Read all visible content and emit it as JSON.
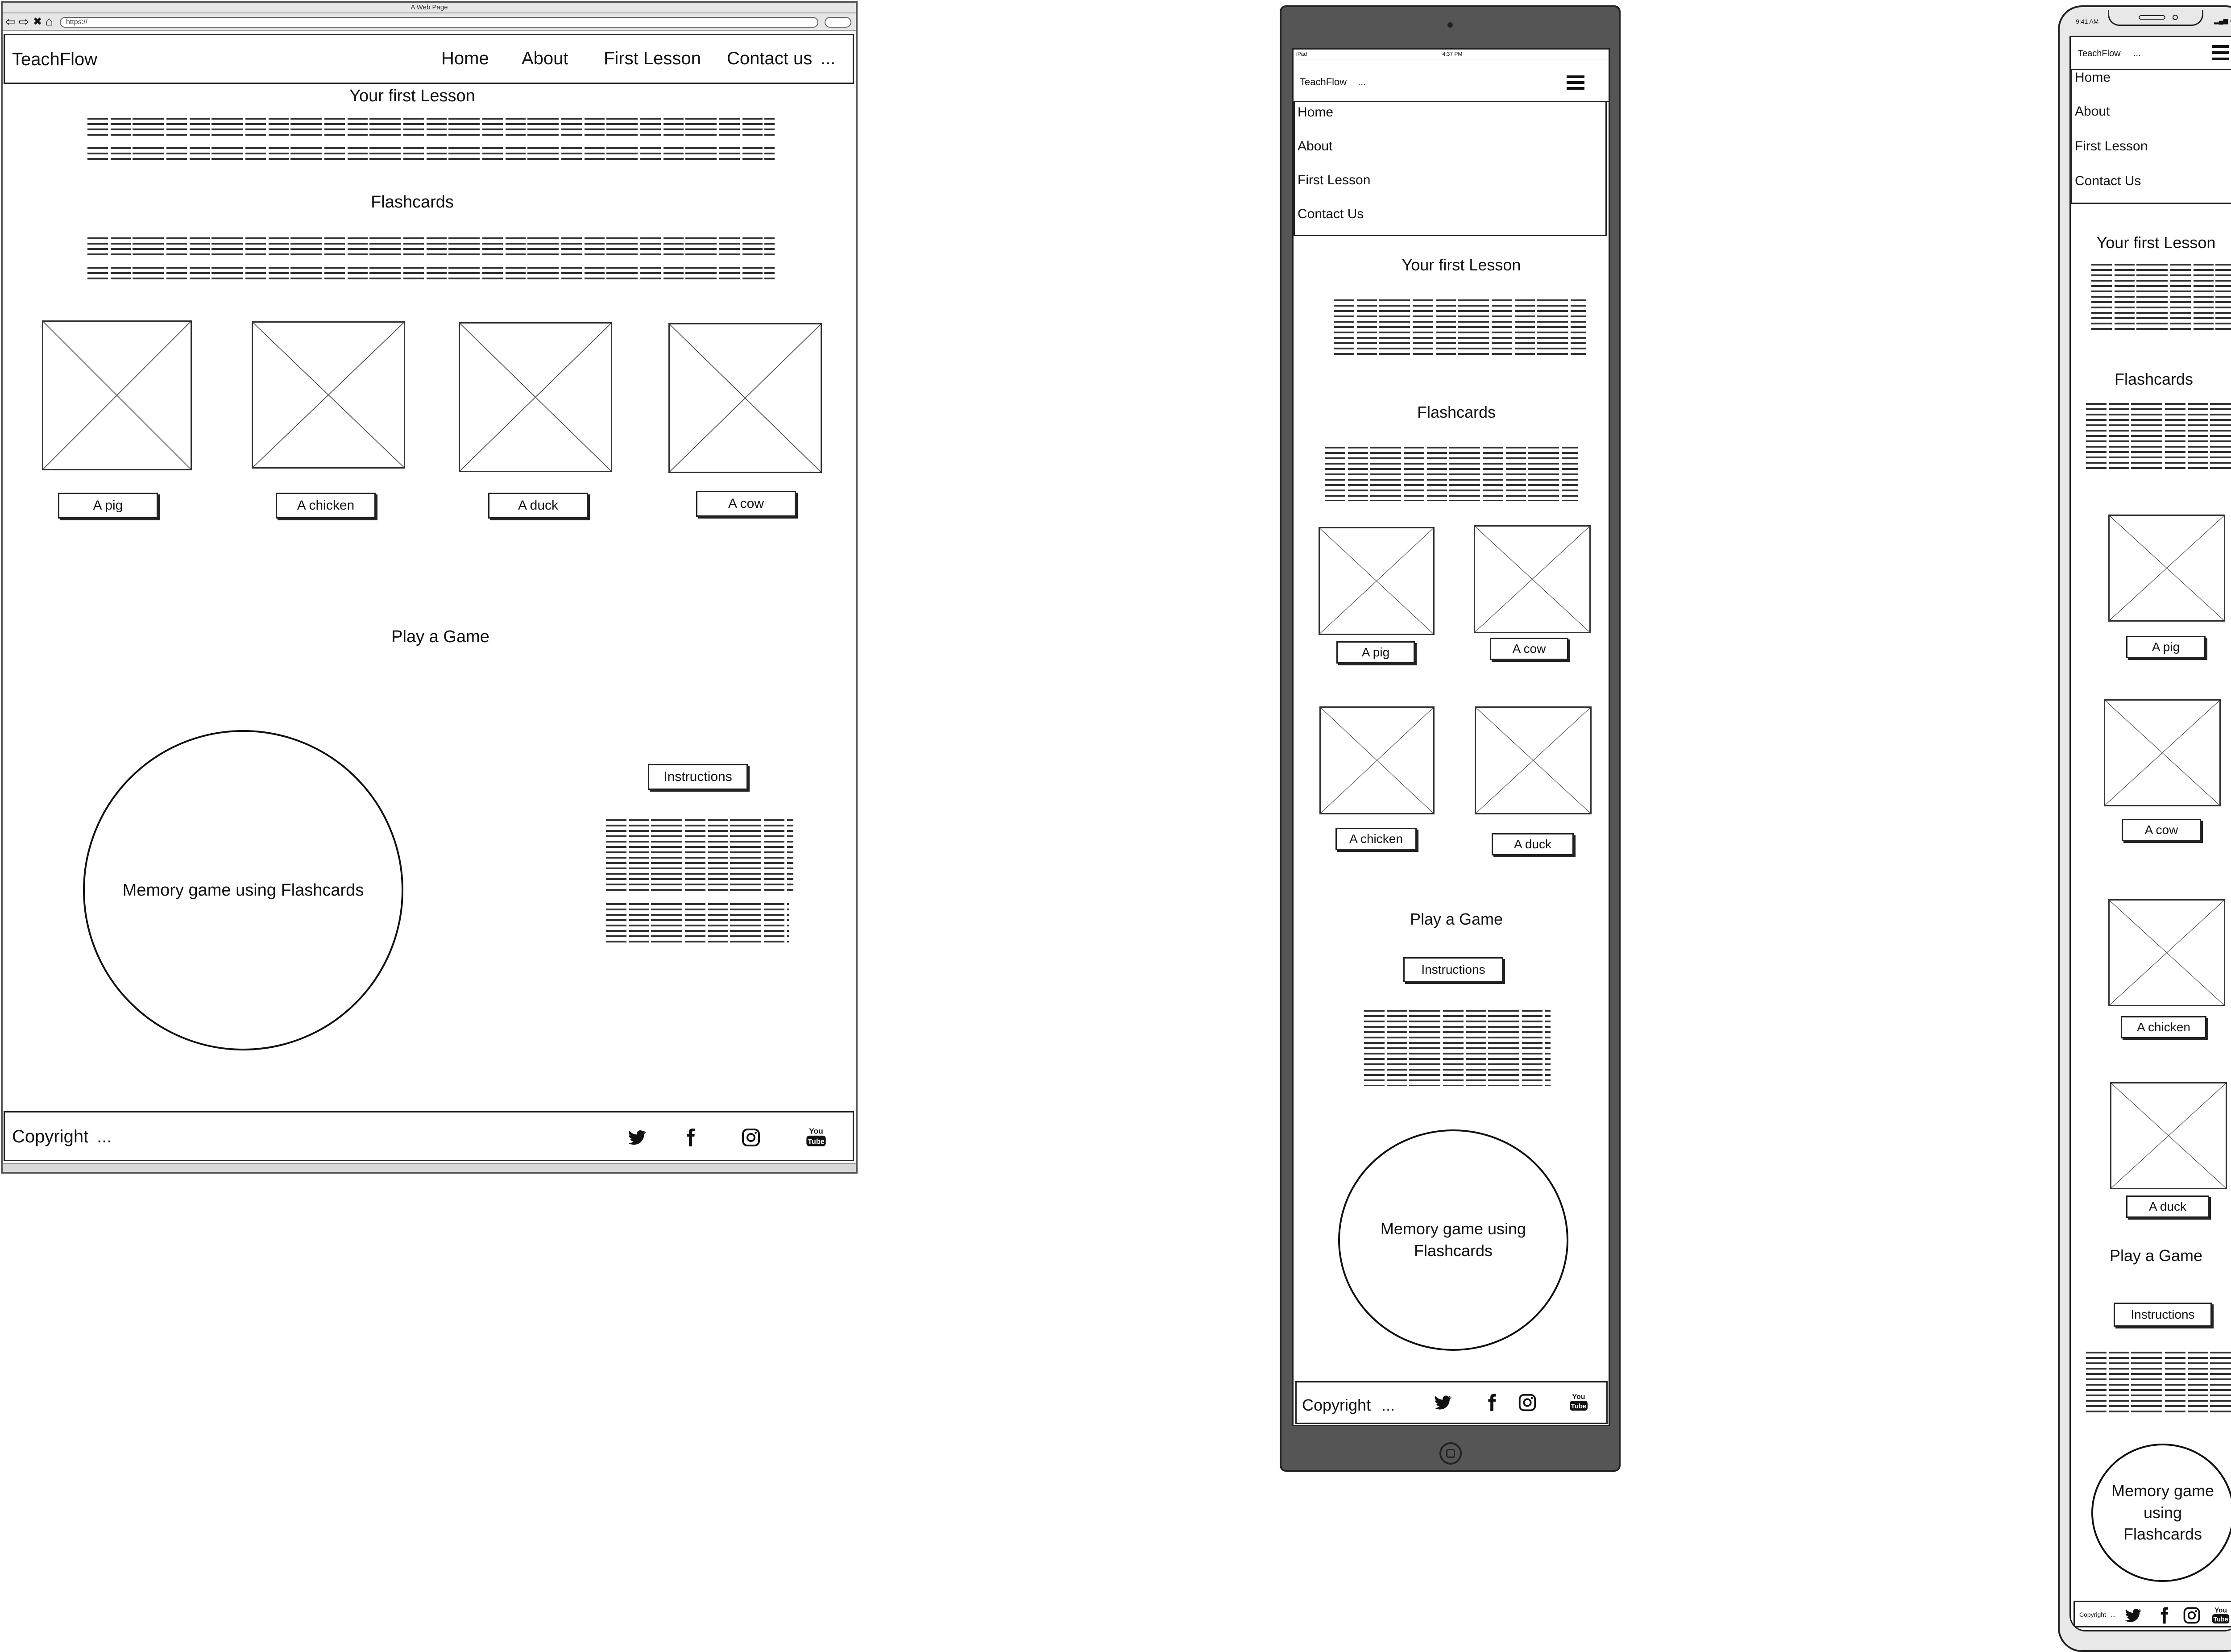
{
  "desktop": {
    "window_title": "A Web Page",
    "url": "https://",
    "brand": "TeachFlow",
    "nav": [
      "Home",
      "About",
      "First Lesson",
      "Contact us"
    ],
    "nav_more": "...",
    "lesson_title": "Your first Lesson",
    "flashcards_title": "Flashcards",
    "cards": [
      "A pig",
      "A chicken",
      "A duck",
      "A cow"
    ],
    "game_title": "Play a Game",
    "game_circle": "Memory game using Flashcards",
    "instructions": "Instructions",
    "copyright": "Copyright",
    "copyright_more": "..."
  },
  "tablet": {
    "status_left": "iPad",
    "status_time": "4:37 PM",
    "brand": "TeachFlow",
    "brand_more": "...",
    "menu": [
      "Home",
      "About",
      "First Lesson",
      "Contact Us"
    ],
    "lesson_title": "Your first Lesson",
    "flashcards_title": "Flashcards",
    "cards": [
      "A pig",
      "A cow",
      "A chicken",
      "A duck"
    ],
    "game_title": "Play a Game",
    "instructions": "Instructions",
    "game_circle": "Memory game using Flashcards",
    "copyright": "Copyright",
    "copyright_more": "..."
  },
  "phone": {
    "status_time": "9:41 AM",
    "brand": "TeachFlow",
    "brand_more": "...",
    "menu": [
      "Home",
      "About",
      "First Lesson",
      "Contact Us"
    ],
    "lesson_title": "Your first Lesson",
    "flashcards_title": "Flashcards",
    "cards": [
      "A pig",
      "A cow",
      "A chicken",
      "A duck"
    ],
    "game_title": "Play a Game",
    "instructions": "Instructions",
    "game_circle": "Memory game using Flashcards",
    "copyright": "Copyright",
    "copyright_more": "..."
  },
  "icons": [
    "twitter-icon",
    "facebook-icon",
    "instagram-icon",
    "youtube-icon",
    "hamburger-menu-icon",
    "home-button-icon"
  ]
}
